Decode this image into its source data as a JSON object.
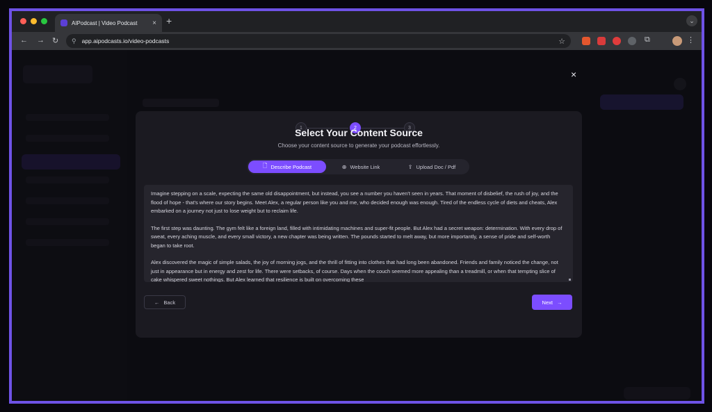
{
  "browser": {
    "tab_title": "AIPodcast | Video Podcast",
    "tab_close": "×",
    "new_tab": "+",
    "tab_menu": "⌄",
    "url": "app.aipodcasts.io/video-podcasts",
    "back": "←",
    "forward": "→",
    "reload": "↻",
    "site_info": "⚲",
    "star": "☆",
    "puzzle": "⧉",
    "kebab": "⋮"
  },
  "colors": {
    "accent": "#7c4dff",
    "frame": "#6e52e6"
  },
  "modal": {
    "close": "×",
    "steps": [
      "1",
      "2",
      "3"
    ],
    "active_step": "2",
    "title": "Select Your Content Source",
    "subtitle": "Choose your content source to generate your podcast effortlessly.",
    "tabs": [
      {
        "label": "Describe Podcast",
        "icon": "document-icon"
      },
      {
        "label": "Website Link",
        "icon": "globe-icon"
      },
      {
        "label": "Upload Doc / Pdf",
        "icon": "upload-icon"
      }
    ],
    "tab_icons": [
      "🗋",
      "⊕",
      "⇪"
    ],
    "paragraphs": [
      "Imagine stepping on a scale, expecting the same old disappointment, but instead, you see a number you haven't seen in years. That moment of disbelief, the rush of joy, and the flood of hope - that's where our story begins. Meet Alex, a regular person like you and me, who decided enough was enough. Tired of the endless cycle of diets and cheats, Alex embarked on a journey not just to lose weight but to reclaim life.",
      "The first step was daunting. The gym felt like a foreign land, filled with intimidating machines and super-fit people. But Alex had a secret weapon: determination. With every drop of sweat, every aching muscle, and every small victory, a new chapter was being written. The pounds started to melt away, but more importantly, a sense of pride and self-worth began to take root.",
      "Alex discovered the magic of simple salads, the joy of morning jogs, and the thrill of fitting into clothes that had long been abandoned. Friends and family noticed the change, not just in appearance but in energy and zest for life. There were setbacks, of course. Days when the couch seemed more appealing than a treadmill, or when that tempting slice of cake whispered sweet nothings. But Alex learned that resilience is built on overcoming these"
    ],
    "back_label": "Back",
    "back_arrow": "←",
    "next_label": "Next",
    "next_arrow": "→"
  }
}
